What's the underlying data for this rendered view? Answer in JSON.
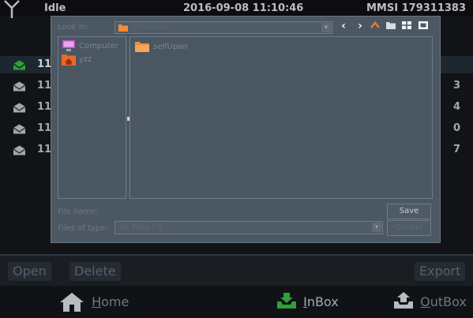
{
  "status_bar": {
    "state": "Idle",
    "datetime": "2016-09-08 11:10:46",
    "mmsi": "MMSI 179311383"
  },
  "message_list": {
    "rows": [
      {
        "id_prefix": "11",
        "tail": "",
        "selected": true
      },
      {
        "id_prefix": "11",
        "tail": "3",
        "selected": false
      },
      {
        "id_prefix": "11",
        "tail": "4",
        "selected": false
      },
      {
        "id_prefix": "11",
        "tail": "0",
        "selected": false
      },
      {
        "id_prefix": "11",
        "tail": "7",
        "selected": false
      }
    ]
  },
  "file_dialog": {
    "look_in_label": "Look in:",
    "look_in_value": "/media/pi",
    "sidebar": [
      {
        "label": "Computer",
        "icon": "computer-icon"
      },
      {
        "label": "yzz",
        "icon": "home-folder-icon"
      }
    ],
    "files": [
      {
        "label": "selfUpan",
        "icon": "folder-icon"
      }
    ],
    "file_name_label": "File name:",
    "file_name_value": "",
    "file_type_label": "Files of type:",
    "file_type_value": "All Files (*)",
    "save_button": "Save",
    "cancel_button": "Cancel"
  },
  "action_bar": {
    "open": "Open",
    "delete": "Delete",
    "export": "Export"
  },
  "nav_bar": {
    "home": "Home",
    "inbox": "InBox",
    "outbox": "OutBox"
  },
  "colors": {
    "accent_green": "#3ac24a",
    "toolbar_up_orange": "#f07a2a",
    "folder_orange": "#f28c3a"
  }
}
